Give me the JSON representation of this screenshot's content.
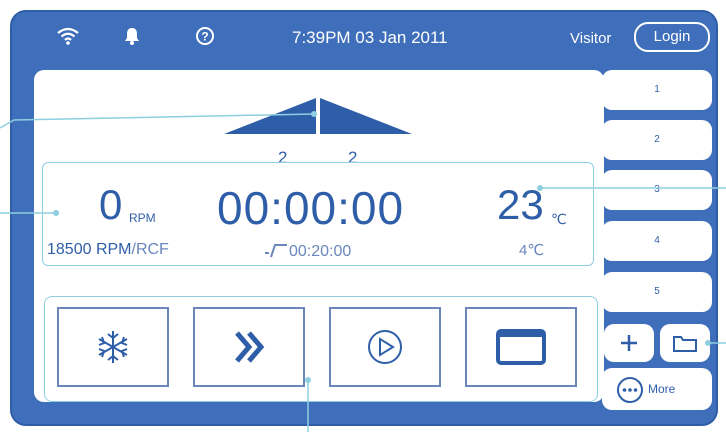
{
  "header": {
    "datetime": "7:39PM 03 Jan 2011",
    "user": "Visitor",
    "login_label": "Login",
    "icons": [
      "wifi-icon",
      "bell-icon",
      "help-icon"
    ]
  },
  "ramp": {
    "accel_label": "2",
    "decel_label": "2"
  },
  "readout": {
    "speed_value": "0",
    "speed_unit": "RPM",
    "time_value": "00:00:00",
    "temp_value": "23",
    "temp_unit": "℃",
    "set_speed": "18500 RPM",
    "set_speed_mode": "/RCF",
    "set_time": "00:20:00",
    "set_temp": "4℃"
  },
  "controls": [
    {
      "name": "precool-button",
      "icon": "snowflake-icon"
    },
    {
      "name": "fast-forward-button",
      "icon": "double-chevron-icon"
    },
    {
      "name": "start-button",
      "icon": "play-circle-icon"
    },
    {
      "name": "lid-button",
      "icon": "window-icon"
    }
  ],
  "programs": [
    "1",
    "2",
    "3",
    "4",
    "5"
  ],
  "actions": {
    "add_icon": "plus-icon",
    "folder_icon": "folder-icon",
    "more_label": "More"
  },
  "colors": {
    "frame": "#3f6fba",
    "accent": "#2f5ea8",
    "muted": "#6a86bd",
    "callout": "#8ecfe0"
  }
}
